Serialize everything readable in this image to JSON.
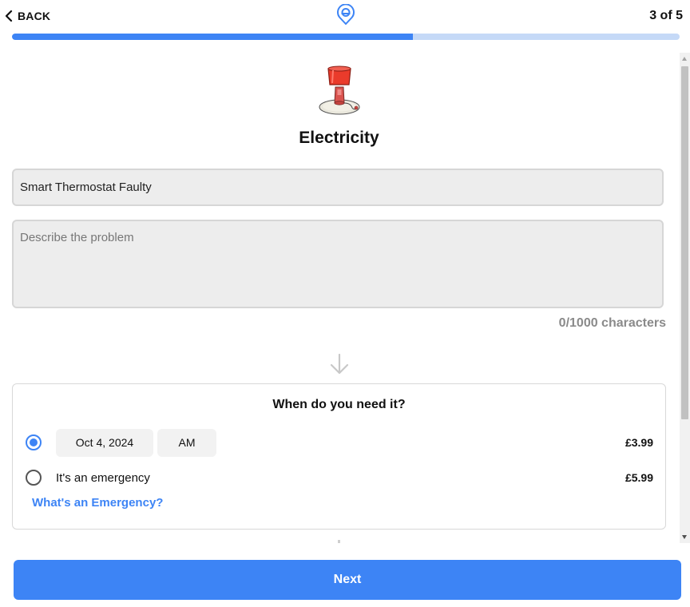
{
  "header": {
    "back_label": "BACK",
    "step_text": "3 of 5",
    "progress_fraction": 0.6
  },
  "service": {
    "title": "Electricity",
    "illustration": "lamp-icon"
  },
  "form": {
    "issue_value": "Smart Thermostat Faulty",
    "description_placeholder": "Describe the problem",
    "counter_text": "0/1000 characters"
  },
  "schedule": {
    "heading": "When do you need it?",
    "option_scheduled": {
      "selected": true,
      "date": "Oct 4, 2024",
      "time_of_day": "AM",
      "price": "£3.99"
    },
    "option_emergency": {
      "selected": false,
      "label": "It's an emergency",
      "price": "£5.99",
      "help_link": "What's an Emergency?"
    }
  },
  "footer": {
    "next_label": "Next"
  },
  "colors": {
    "accent": "#3d84f5",
    "progress_track": "#c5d9f7"
  }
}
